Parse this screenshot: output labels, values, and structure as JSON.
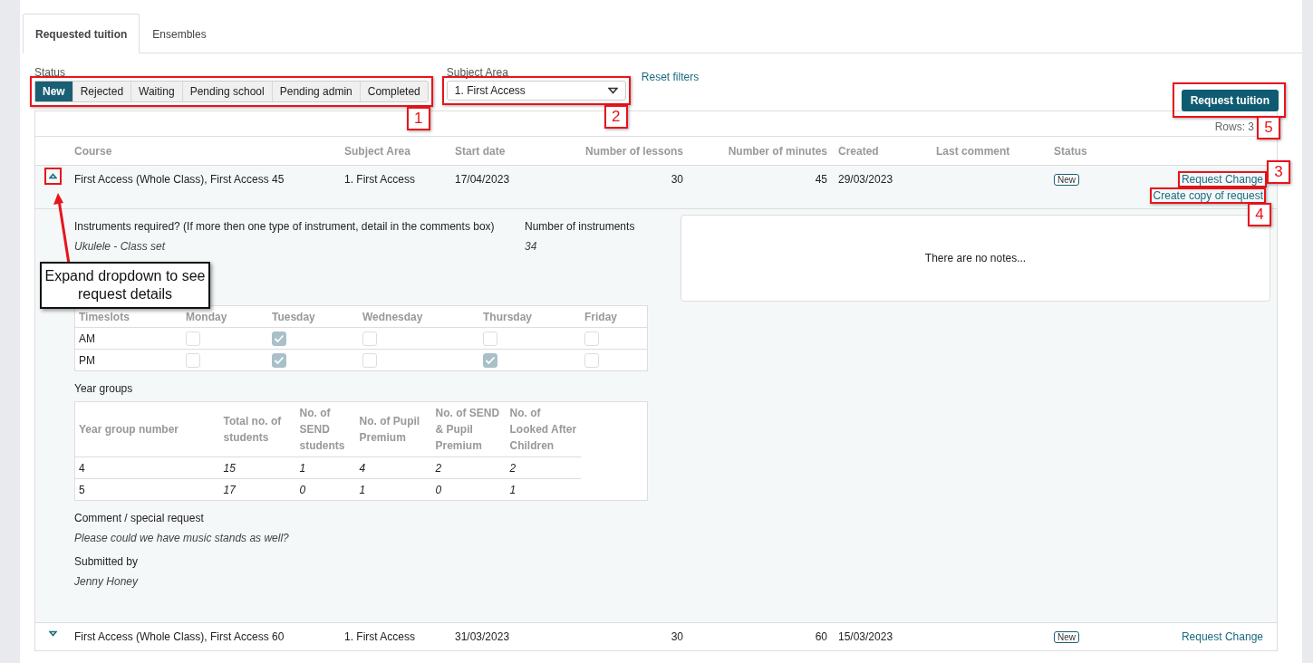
{
  "tabs": [
    {
      "label": "Requested tuition",
      "selected": true
    },
    {
      "label": "Ensembles",
      "selected": false
    }
  ],
  "filters": {
    "status_label": "Status",
    "status_annotation": "1",
    "status_options": [
      {
        "label": "New",
        "selected": true
      },
      {
        "label": "Rejected",
        "selected": false
      },
      {
        "label": "Waiting",
        "selected": false
      },
      {
        "label": "Pending school",
        "selected": false
      },
      {
        "label": "Pending admin",
        "selected": false
      },
      {
        "label": "Completed",
        "selected": false
      }
    ],
    "subject_label": "Subject Area",
    "subject_value": "1. First Access",
    "subject_annotation": "2",
    "reset": "Reset filters"
  },
  "request_button": {
    "label": "Request tuition",
    "annotation": "5"
  },
  "rows_count": "Rows: 3",
  "table": {
    "columns": [
      "Course",
      "Subject Area",
      "Start date",
      "Number of lessons",
      "Number of minutes",
      "Created",
      "Last comment",
      "Status"
    ],
    "rows": [
      {
        "expanded": true,
        "course": "First Access (Whole Class), First Access 45",
        "subject": "1. First Access",
        "start": "17/04/2023",
        "lessons": "30",
        "minutes": "45",
        "created": "29/03/2023",
        "status": "New",
        "actions": [
          {
            "label": "Request Change",
            "annotation": "3"
          },
          {
            "label": "Create copy of request",
            "annotation": "4"
          }
        ],
        "details": {
          "instruments_label": "Instruments required? (If more then one type of instrument, detail in the comments box)",
          "instruments_value": "Ukulele - Class set",
          "number_label": "Number of instruments",
          "number_value": "34",
          "notes": "There are no notes...",
          "timeslots": {
            "columns": [
              "Timeslots",
              "Monday",
              "Tuesday",
              "Wednesday",
              "Thursday",
              "Friday"
            ],
            "rows": [
              {
                "label": "AM",
                "checked": [
                  false,
                  true,
                  false,
                  false,
                  false
                ]
              },
              {
                "label": "PM",
                "checked": [
                  false,
                  true,
                  false,
                  true,
                  false
                ]
              }
            ]
          },
          "year_groups_label": "Year groups",
          "year_groups": {
            "columns": [
              "Year group number",
              "Total no. of students",
              "No. of SEND students",
              "No. of Pupil Premium",
              "No. of SEND & Pupil Premium",
              "No. of Looked After Children"
            ],
            "rows": [
              [
                "4",
                "15",
                "1",
                "4",
                "2",
                "2"
              ],
              [
                "5",
                "17",
                "0",
                "1",
                "0",
                "1"
              ]
            ]
          },
          "comment_label": "Comment / special request",
          "comment_value": "Please could we have music stands as well?",
          "submitted_label": "Submitted by",
          "submitted_value": "Jenny Honey"
        }
      },
      {
        "expanded": false,
        "course": "First Access (Whole Class), First Access 60",
        "subject": "1. First Access",
        "start": "31/03/2023",
        "lessons": "30",
        "minutes": "60",
        "created": "15/03/2023",
        "status": "New",
        "actions": [
          {
            "label": "Request Change"
          }
        ]
      }
    ]
  },
  "callout": "Expand dropdown to see request details"
}
